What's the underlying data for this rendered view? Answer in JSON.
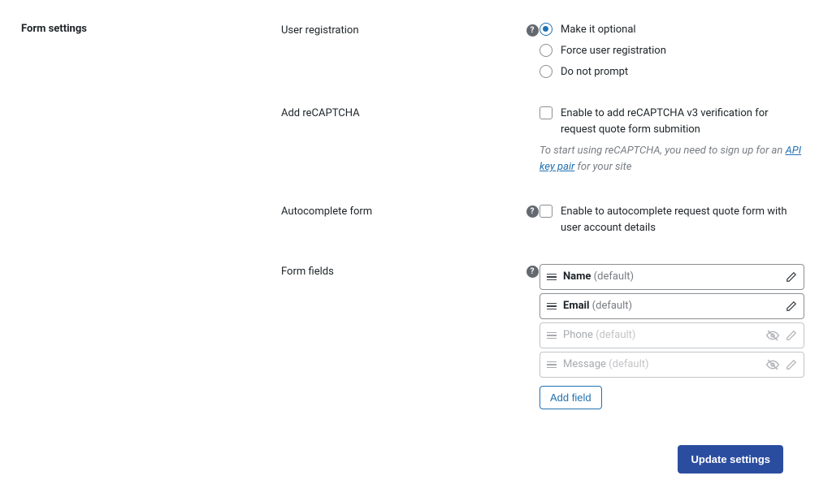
{
  "section_heading": "Form settings",
  "user_registration": {
    "label": "User registration",
    "options": {
      "optional": "Make it optional",
      "force": "Force user registration",
      "noprompt": "Do not prompt"
    }
  },
  "recaptcha": {
    "label": "Add reCAPTCHA",
    "checkbox_label": "Enable to add reCAPTCHA v3 verification for request quote form submition",
    "hint_prefix": "To start using reCAPTCHA, you need to sign up for an ",
    "hint_link": "API key pair",
    "hint_suffix": " for your site"
  },
  "autocomplete": {
    "label": "Autocomplete form",
    "checkbox_label": "Enable to autocomplete request quote form with user account details"
  },
  "form_fields": {
    "label": "Form fields",
    "default_suffix": "(default)",
    "items": [
      {
        "name": "Name",
        "enabled": true
      },
      {
        "name": "Email",
        "enabled": true
      },
      {
        "name": "Phone",
        "enabled": false
      },
      {
        "name": "Message",
        "enabled": false
      }
    ],
    "add_button": "Add field"
  },
  "update_button": "Update settings"
}
